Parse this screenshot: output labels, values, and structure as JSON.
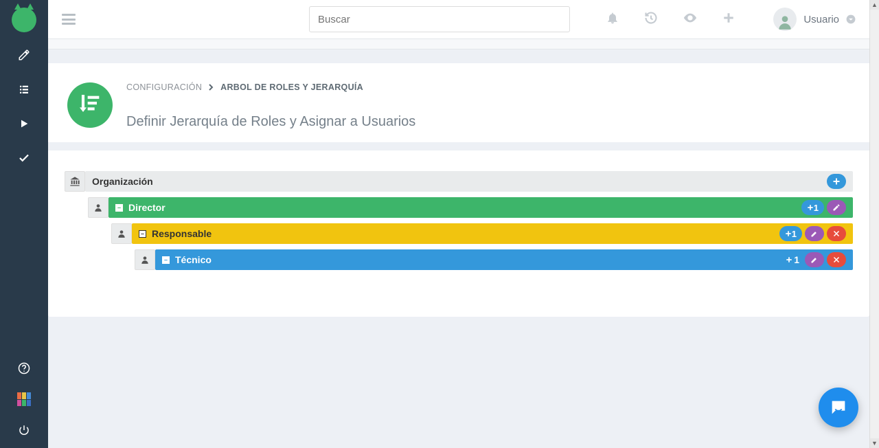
{
  "topbar": {
    "search_placeholder": "Buscar",
    "user_label": "Usuario"
  },
  "breadcrumb": {
    "parent": "CONFIGURACIÓN",
    "current": "ARBOL DE ROLES Y JERARQUÍA"
  },
  "page": {
    "title": "Definir Jerarquía de Roles y Asignar a Usuarios"
  },
  "tree": {
    "root_label": "Organización",
    "nodes": [
      {
        "label": "Director",
        "add_count": "1"
      },
      {
        "label": "Responsable",
        "add_count": "1"
      },
      {
        "label": "Técnico",
        "add_count": "1"
      }
    ]
  },
  "colors": {
    "brand_green": "#3db56a",
    "row_yellow": "#f1c40f",
    "row_blue": "#3498db",
    "pill_purple": "#9b59b6",
    "pill_red": "#e74c3c",
    "sidebar_bg": "#293a4a"
  }
}
